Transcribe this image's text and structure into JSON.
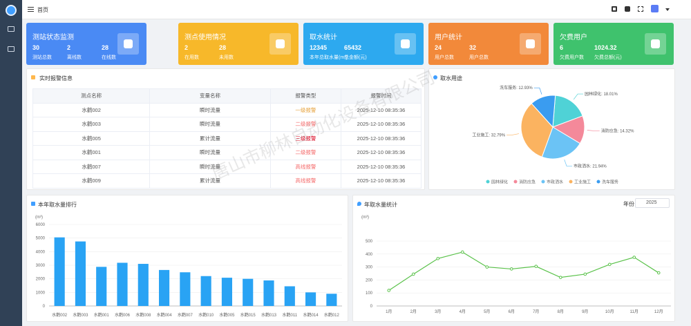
{
  "header": {
    "breadcrumb": "首页"
  },
  "stats": [
    {
      "title": "测站状态监测",
      "color": "#4a8af4",
      "items": [
        {
          "value": "30",
          "label": "测站总数"
        },
        {
          "value": "2",
          "label": "离线数"
        },
        {
          "value": "28",
          "label": "在线数"
        }
      ]
    },
    {
      "title": "测点使用情况",
      "color": "#f7b82a",
      "items": [
        {
          "value": "2",
          "label": "在用数"
        },
        {
          "value": "28",
          "label": "未用数"
        }
      ]
    },
    {
      "title": "取水统计",
      "color": "#2da9ef",
      "items": [
        {
          "value": "12345",
          "label": "本年总取水量(m³)"
        },
        {
          "value": "65432",
          "label": "总金额(元)"
        }
      ]
    },
    {
      "title": "用户统计",
      "color": "#f2893a",
      "items": [
        {
          "value": "24",
          "label": "用户总数"
        },
        {
          "value": "32",
          "label": "用户总数"
        }
      ]
    },
    {
      "title": "欠费用户",
      "color": "#3fc26d",
      "items": [
        {
          "value": "6",
          "label": "欠费用户数"
        },
        {
          "value": "1024.32",
          "label": "欠费总额(元)"
        }
      ]
    }
  ],
  "alarms": {
    "title": "实时报警信息",
    "columns": [
      "测点名称",
      "变量名称",
      "报警类型",
      "报警时间"
    ],
    "rows": [
      [
        "水鹳002",
        "瞬时流量",
        "一级报警",
        "2025-12-10 08:35:36"
      ],
      [
        "水鹳003",
        "瞬时流量",
        "二级报警",
        "2025-12-10 08:35:36"
      ],
      [
        "水鹳005",
        "累计流量",
        "三级报警",
        "2025-12-10 08:35:36"
      ],
      [
        "水鹳001",
        "瞬时流量",
        "二级报警",
        "2025-12-10 08:35:36"
      ],
      [
        "水鹳007",
        "瞬时流量",
        "高线报警",
        "2025-12-10 08:35:36"
      ],
      [
        "水鹳009",
        "累计流量",
        "高线报警",
        "2025-12-10 08:35:36"
      ]
    ]
  },
  "usage": {
    "title": "取水用途"
  },
  "ranking": {
    "title": "本年取水量排行"
  },
  "yearly": {
    "title": "年取水量统计",
    "year_label": "年份",
    "year_value": "2025"
  },
  "watermark": "唐山市柳林自动化设备有限公司",
  "chart_data": [
    {
      "type": "pie",
      "labels": [
        "园林绿化",
        "消防应急",
        "市政洒水",
        "工业施工",
        "洗车服务"
      ],
      "values": [
        18.01,
        14.32,
        21.94,
        32.79,
        12.93
      ],
      "slice_labels": [
        "园林绿化: 18.01%",
        "消防应急: 14.32%",
        "市政洒水: 21.94%",
        "工业施工: 32.79%",
        "洗车服务: 12.93%"
      ],
      "colors": [
        "#4fd2d6",
        "#f4899a",
        "#6bc3f5",
        "#fbb360",
        "#3a9cf0"
      ],
      "legend_position": "bottom"
    },
    {
      "type": "bar",
      "ylabel": "(m³)",
      "categories": [
        "水鹳002",
        "水鹳003",
        "水鹳001",
        "水鹳006",
        "水鹳008",
        "水鹳004",
        "水鹳007",
        "水鹳010",
        "水鹳005",
        "水鹳015",
        "水鹳013",
        "水鹳011",
        "水鹳014",
        "水鹳012"
      ],
      "values": [
        5050,
        4750,
        2880,
        3180,
        3100,
        2650,
        2480,
        2200,
        2080,
        2000,
        1880,
        1450,
        1000,
        900
      ],
      "ylim": [
        0,
        6000
      ],
      "yticks": [
        "0",
        "1000",
        "2000",
        "3000",
        "4000",
        "5000",
        "6000"
      ],
      "color": "#29a3f4"
    },
    {
      "type": "line",
      "ylabel": "(m³)",
      "categories": [
        "1月",
        "2月",
        "3月",
        "4月",
        "5月",
        "6月",
        "7月",
        "8月",
        "9月",
        "10月",
        "11月",
        "12月"
      ],
      "values": [
        120,
        245,
        365,
        415,
        300,
        285,
        305,
        220,
        245,
        320,
        375,
        255
      ],
      "ylim": [
        0,
        500
      ],
      "yticks": [
        "0",
        "100",
        "200",
        "300",
        "400",
        "500"
      ],
      "color": "#5ac24a"
    }
  ]
}
